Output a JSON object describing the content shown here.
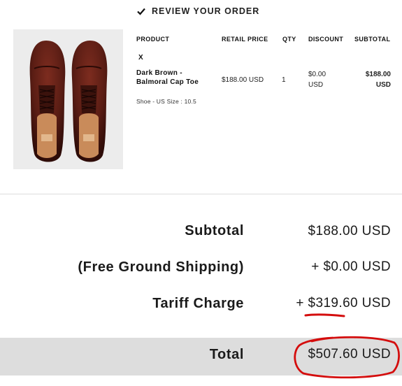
{
  "review": {
    "title": "REVIEW YOUR ORDER",
    "icon": "check-icon"
  },
  "table": {
    "headers": {
      "product": "PRODUCT",
      "retail_price": "RETAIL PRICE",
      "qty": "QTY",
      "discount": "DISCOUNT",
      "subtotal": "SUBTOTAL"
    }
  },
  "item": {
    "remove_label": "X",
    "name": "Dark Brown - Balmoral Cap Toe",
    "variant": "Shoe - US Size : 10.5",
    "retail_price": "$188.00 USD",
    "qty": "1",
    "discount": "$0.00 USD",
    "subtotal": "$188.00 USD"
  },
  "summary": {
    "subtotal_label": "Subtotal",
    "subtotal_value": "$188.00 USD",
    "shipping_label": "(Free Ground Shipping)",
    "shipping_value": "+ $0.00 USD",
    "tariff_label": "Tariff Charge",
    "tariff_value": "+ $319.60 USD",
    "total_label": "Total",
    "total_value": "$507.60 USD"
  },
  "colors": {
    "annotation": "#d40d0d",
    "total_band": "#dddddd",
    "shoe_leather": "#5a1d14"
  }
}
